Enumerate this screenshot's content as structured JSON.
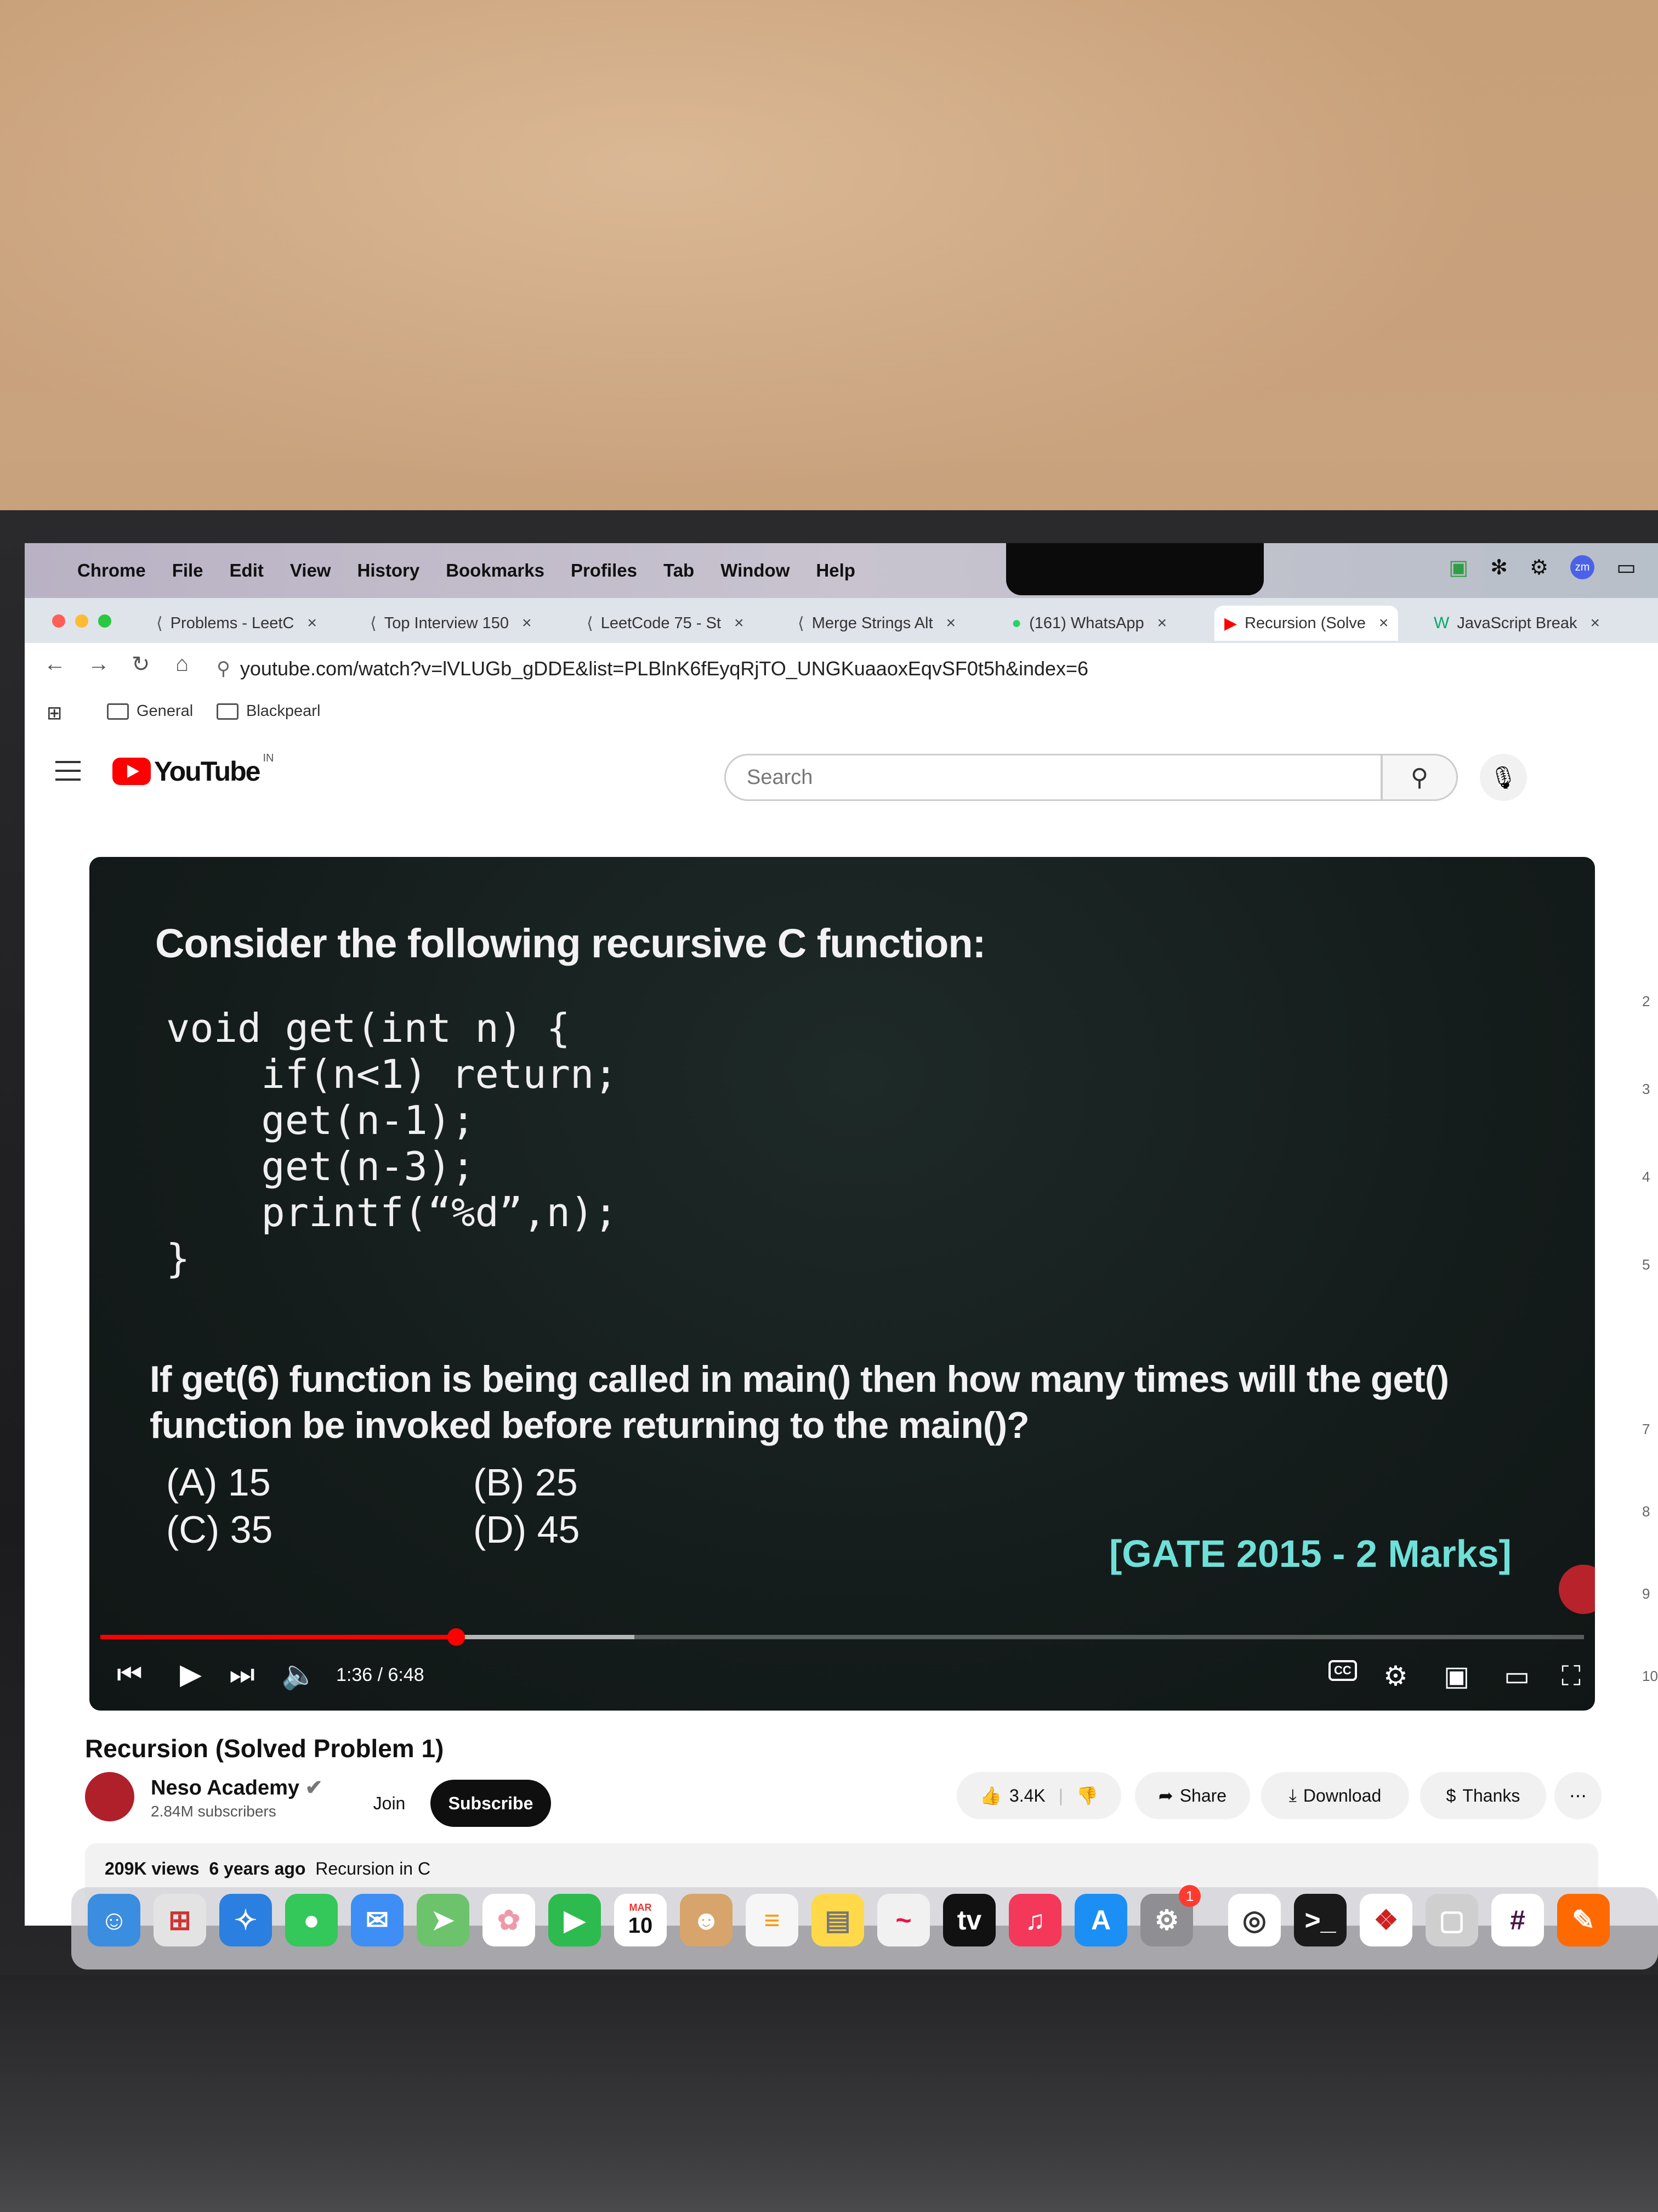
{
  "menubar": {
    "items": [
      "Chrome",
      "File",
      "Edit",
      "View",
      "History",
      "Bookmarks",
      "Profiles",
      "Tab",
      "Window",
      "Help"
    ]
  },
  "tabs": [
    {
      "label": "Problems - LeetC",
      "icon": "leetcode-icon"
    },
    {
      "label": "Top Interview 150",
      "icon": "leetcode-icon"
    },
    {
      "label": "LeetCode 75 - St",
      "icon": "leetcode-icon"
    },
    {
      "label": "Merge Strings Alt",
      "icon": "leetcode-icon"
    },
    {
      "label": "(161) WhatsApp",
      "icon": "whatsapp-icon"
    },
    {
      "label": "Recursion (Solve",
      "icon": "youtube-icon"
    },
    {
      "label": "JavaScript Break",
      "icon": "w3schools-icon"
    }
  ],
  "toolbar": {
    "url": "youtube.com/watch?v=lVLUGb_gDDE&list=PLBlnK6fEyqRjTO_UNGKuaaoxEqvSF0t5h&index=6"
  },
  "bookmarks": [
    "General",
    "Blackpearl"
  ],
  "youtube": {
    "logo_text": "YouTube",
    "region": "IN",
    "search_placeholder": "Search"
  },
  "video": {
    "heading": "Consider the following recursive C function:",
    "code_lines": [
      "void get(int n) {",
      "    if(n<1) return;",
      "    get(n-1);",
      "    get(n-3);",
      "    printf(“%d”,n);",
      "}"
    ],
    "question": "If get(6) function is being called in main() then how many times will the get() function be invoked before returning to the main()?",
    "options": [
      "(A) 15",
      "(B) 25",
      "(C) 35",
      "(D) 45"
    ],
    "tag": "[GATE 2015 - 2 Marks]",
    "time": "1:36 / 6:48",
    "progress": 0.24,
    "buffered": 0.36
  },
  "below": {
    "title": "Recursion (Solved Problem 1)",
    "channel": "Neso Academy",
    "subscribers": "2.84M subscribers",
    "join": "Join",
    "subscribe": "Subscribe",
    "likes": "3.4K",
    "share": "Share",
    "download": "Download",
    "thanks": "Thanks",
    "views": "209K views",
    "age": "6 years ago",
    "playlist": "Recursion in C"
  },
  "dock": {
    "calendar_month": "MAR",
    "calendar_day": "10",
    "tv_label": "tv",
    "badge": "1"
  },
  "sidebar_numbers": [
    "2",
    "3",
    "4",
    "5",
    "7",
    "8",
    "9",
    "10"
  ]
}
